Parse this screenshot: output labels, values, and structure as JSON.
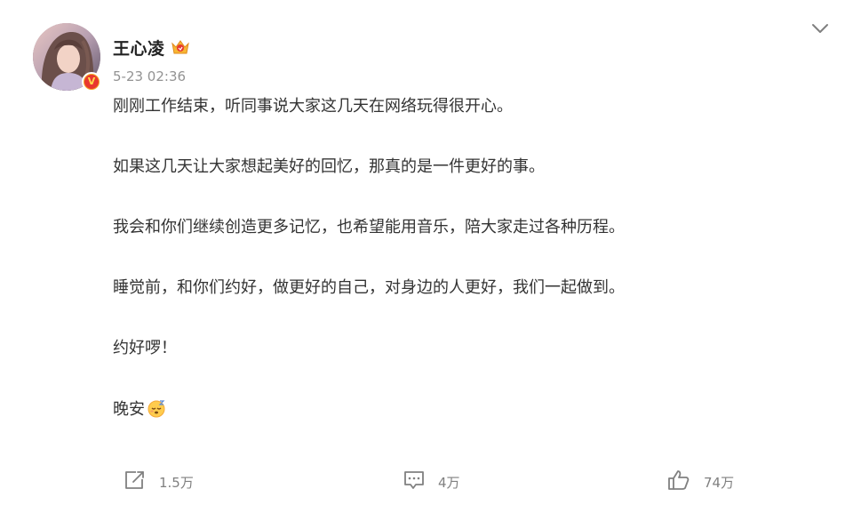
{
  "post": {
    "author": "王心凌",
    "timestamp": "5-23 02:36",
    "paragraphs": [
      "刚刚工作结束，听同事说大家这几天在网络玩得很开心。",
      "如果这几天让大家想起美好的回忆，那真的是一件更好的事。",
      "我会和你们继续创造更多记忆，也希望能用音乐，陪大家走过各种历程。",
      "睡觉前，和你们约好，做更好的自己，对身边的人更好，我们一起做到。",
      "约好啰！",
      "晚安"
    ],
    "closing_emoji": "sleepy-face-emoji"
  },
  "badges": {
    "verified_letter": "V",
    "verified_colors": {
      "ring": "#f5a623",
      "fill": "#e8382f",
      "letter": "#ffd94a"
    },
    "vip_icon": "crown-vip-icon"
  },
  "actions": {
    "repost": {
      "icon": "repost-icon",
      "count": "1.5万"
    },
    "comment": {
      "icon": "comment-icon",
      "count": "4万"
    },
    "like": {
      "icon": "thumbs-up-icon",
      "count": "74万"
    }
  },
  "menu": {
    "icon": "chevron-down-icon"
  },
  "colors": {
    "text": "#333333",
    "muted": "#939393",
    "action_text": "#808080"
  }
}
